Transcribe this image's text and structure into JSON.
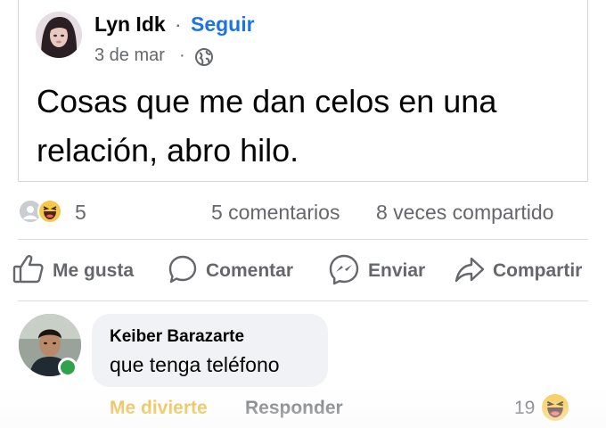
{
  "post": {
    "author_name": "Lyn Idk",
    "separator": "·",
    "follow_label": "Seguir",
    "date": "3 de mar",
    "date_separator": "·",
    "privacy_icon": "globe-icon",
    "text": "Cosas que me dan celos en una relación, abro hilo."
  },
  "stats": {
    "reaction_icons": [
      "like-icon",
      "haha-icon"
    ],
    "reaction_count": "5",
    "comments": "5 comentarios",
    "shares": "8 veces compartido"
  },
  "actions": [
    {
      "label": "Me gusta",
      "icon": "thumbs-up-icon"
    },
    {
      "label": "Comentar",
      "icon": "comment-icon"
    },
    {
      "label": "Enviar",
      "icon": "messenger-icon"
    },
    {
      "label": "Compartir",
      "icon": "share-icon"
    }
  ],
  "comment": {
    "author_name": "Keiber Barazarte",
    "text": "que tenga teléfono",
    "online": true,
    "reaction_label": "Me divierte",
    "reply_label": "Responder",
    "reaction_count": "19",
    "reaction_icon": "haha-icon"
  },
  "colors": {
    "follow": "#1b74e4",
    "secondary_text": "#65676b",
    "haha_label": "#e7b52c",
    "online": "#31a24c",
    "bubble": "#f0f2f5"
  }
}
